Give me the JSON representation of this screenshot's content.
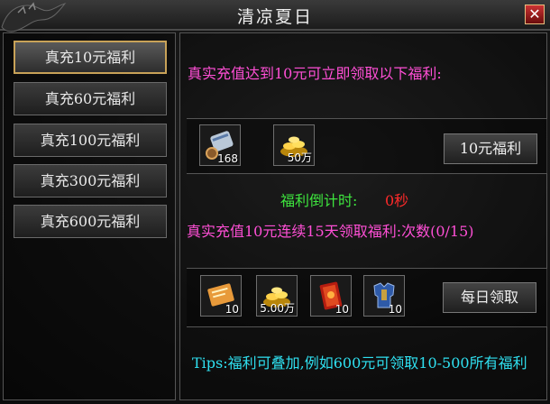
{
  "window": {
    "title": "清凉夏日",
    "close_label": "✕"
  },
  "tabs": [
    {
      "label": "真充10元福利",
      "active": true
    },
    {
      "label": "真充60元福利",
      "active": false
    },
    {
      "label": "真充100元福利",
      "active": false
    },
    {
      "label": "真充300元福利",
      "active": false
    },
    {
      "label": "真充600元福利",
      "active": false
    }
  ],
  "reward1": {
    "heading": "真实充值达到10元可立即领取以下福利:",
    "items": [
      {
        "icon": "scroll-icon",
        "count": "168"
      },
      {
        "icon": "gold-pile-icon",
        "count": "50万"
      }
    ],
    "button_label": "10元福利"
  },
  "countdown": {
    "label": "福利倒计时:",
    "value": "0秒"
  },
  "reward2": {
    "heading": "真实充值10元连续15天领取福利:次数(0/15)",
    "items": [
      {
        "icon": "ticket-icon",
        "count": "10"
      },
      {
        "icon": "gold-pile-icon",
        "count": "5.00万"
      },
      {
        "icon": "red-book-icon",
        "count": "10"
      },
      {
        "icon": "armor-icon",
        "count": "10"
      }
    ],
    "button_label": "每日领取"
  },
  "tips": "Tips:福利可叠加,例如600元可领取10-500所有福利",
  "colors": {
    "pink": "#ff4fd6",
    "green": "#3ee63e",
    "red": "#ff2a2a",
    "cyan": "#2fe0f0",
    "active_border": "#c8a258"
  }
}
